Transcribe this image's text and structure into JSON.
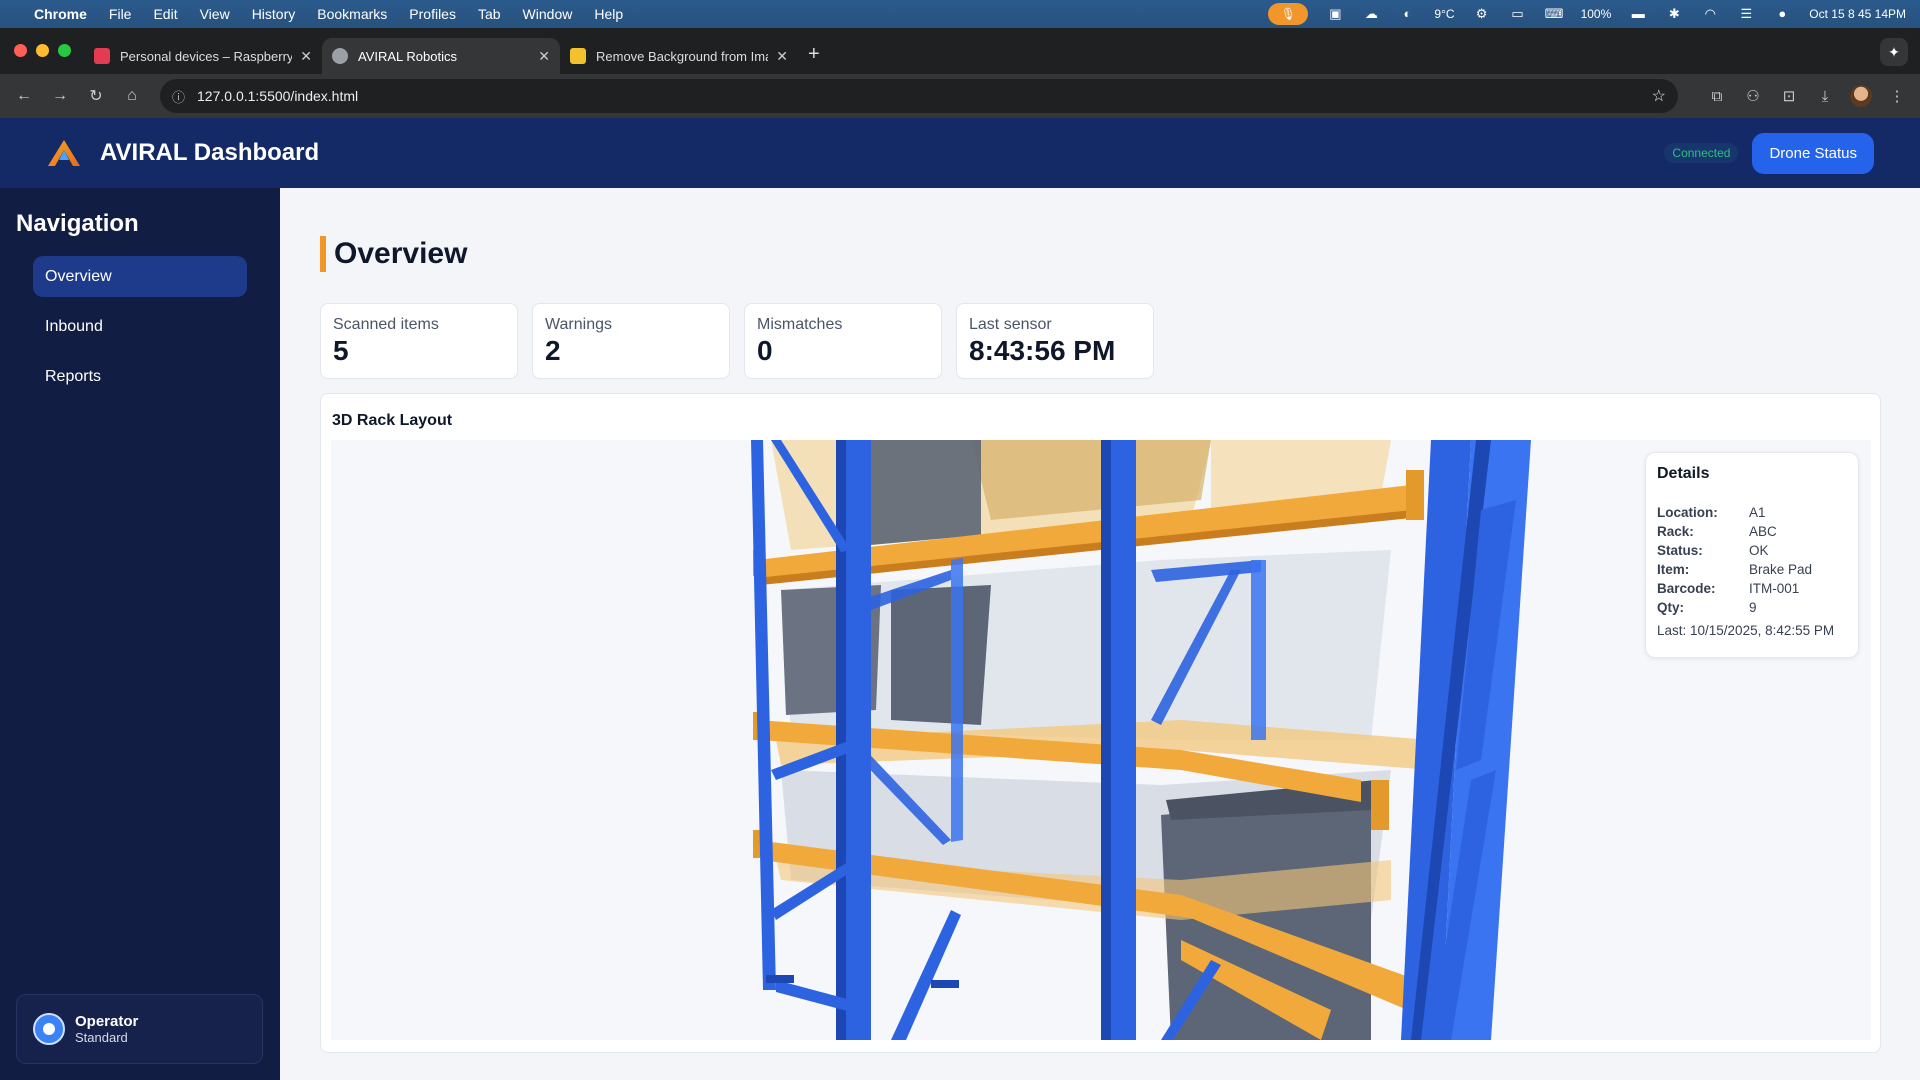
{
  "menubar": {
    "app": "Chrome",
    "items": [
      "File",
      "Edit",
      "View",
      "History",
      "Bookmarks",
      "Profiles",
      "Tab",
      "Window",
      "Help"
    ],
    "weather": "9°C",
    "battery": "100%",
    "clock": "Oct 15  8 45 14PM"
  },
  "browser": {
    "tabs": [
      {
        "title": "Personal devices – Raspberry",
        "favicon_color": "#e23b52"
      },
      {
        "title": "AVIRAL Robotics",
        "favicon_color": "#9aa0a6"
      },
      {
        "title": "Remove Background from Ima",
        "favicon_color": "#f3c12b"
      }
    ],
    "url": "127.0.0.1:5500/index.html"
  },
  "app": {
    "title": "AVIRAL Dashboard",
    "connection": "Connected",
    "drone_button": "Drone Status"
  },
  "sidebar": {
    "title": "Navigation",
    "items": [
      {
        "label": "Overview",
        "active": true
      },
      {
        "label": "Inbound",
        "active": false
      },
      {
        "label": "Reports",
        "active": false
      }
    ],
    "operator": {
      "role": "Operator",
      "level": "Standard"
    }
  },
  "main": {
    "title": "Overview",
    "stats": [
      {
        "label": "Scanned items",
        "value": "5"
      },
      {
        "label": "Warnings",
        "value": "2"
      },
      {
        "label": "Mismatches",
        "value": "0"
      },
      {
        "label": "Last sensor",
        "value": "8:43:56 PM"
      }
    ],
    "rack": {
      "title": "3D Rack Layout",
      "details": {
        "heading": "Details",
        "fields": [
          {
            "key": "Location:",
            "value": "A1"
          },
          {
            "key": "Rack:",
            "value": "ABC"
          },
          {
            "key": "Status:",
            "value": "OK"
          },
          {
            "key": "Item:",
            "value": "Brake Pad"
          },
          {
            "key": "Barcode:",
            "value": "ITM-001"
          },
          {
            "key": "Qty:",
            "value": "9"
          }
        ],
        "last": "Last: 10/15/2025, 8:42:55 PM"
      }
    }
  },
  "colors": {
    "accent": "#f0962a",
    "header": "#142a66",
    "sidebar": "#121d44",
    "primary": "#2563eb",
    "rack_blue": "#2d63e0",
    "beam_orange": "#f2b441"
  }
}
